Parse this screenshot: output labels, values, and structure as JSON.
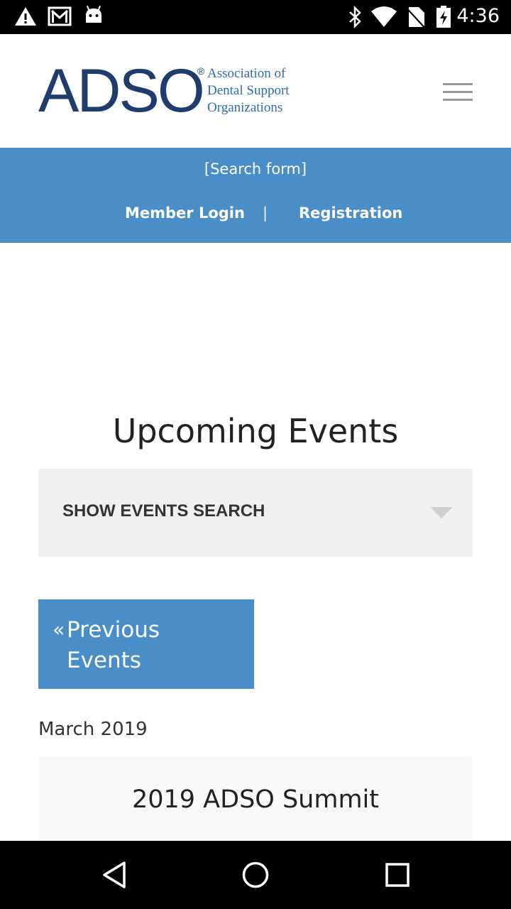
{
  "status_bar": {
    "time": "4:36",
    "left_icons": [
      "warning-icon",
      "gmail-icon",
      "android-icon"
    ],
    "right_icons": [
      "bluetooth-icon",
      "wifi-icon",
      "no-sim-icon",
      "battery-charging-icon"
    ]
  },
  "header": {
    "logo_mark": "ADSO",
    "logo_registered": "®",
    "logo_lines": [
      "Association of",
      "Dental Support",
      "Organizations"
    ],
    "menu_icon": "hamburger-icon"
  },
  "top_bar": {
    "search_form": "[Search form]",
    "member_login": "Member Login",
    "separator": "|",
    "registration": "Registration"
  },
  "main": {
    "title": "Upcoming Events",
    "events_search_label": "SHOW EVENTS SEARCH",
    "prev_chevron": "«",
    "prev_label": "Previous Events",
    "month": "March 2019",
    "event_title": "2019 ADSO Summit"
  },
  "colors": {
    "brand_blue": "#4a8ec9",
    "logo_navy": "#1f3c6e",
    "logo_text_blue": "#2f6cb3"
  },
  "nav_bar": {
    "icons": [
      "back-icon",
      "home-icon",
      "recents-icon"
    ]
  }
}
